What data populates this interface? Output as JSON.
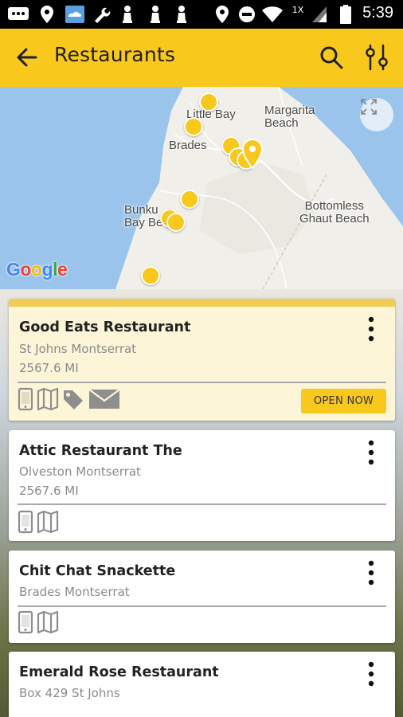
{
  "status_bar": {
    "time": "5:39",
    "icons": [
      "messages-icon",
      "location-pin-icon",
      "weather-icon",
      "wrench-icon",
      "chess-piece-icon",
      "chess-piece-icon",
      "chess-piece-icon",
      "location-icon",
      "do-not-disturb-icon",
      "wifi-icon",
      "signal-icon",
      "battery-icon"
    ],
    "signal_label": "1X"
  },
  "app_bar": {
    "title": "Restaurants",
    "background_color": "#f8c81c",
    "icons": [
      "back-arrow-icon",
      "search-icon",
      "filter-sliders-icon"
    ]
  },
  "map": {
    "labels": {
      "little_bay": "Little Bay",
      "margarita_beach": "Margarita\nBeach",
      "brades": "Brades",
      "bunkum_bay": "Bunku\nBay Be",
      "bottomless": "Bottomless\nGhaut Beach"
    },
    "google_logo": "Google",
    "expand_icon": "fullscreen-expand-icon",
    "pin_color": "#f8c81c"
  },
  "restaurants": [
    {
      "name": "Good Eats Restaurant",
      "address": "St Johns Montserrat",
      "distance": "2567.6 MI",
      "icons": [
        "phone-icon",
        "map-icon",
        "tag-icon",
        "mail-icon"
      ],
      "badge": "OPEN NOW",
      "highlighted": true
    },
    {
      "name": "Attic Restaurant The",
      "address": "Olveston Montserrat",
      "distance": "2567.6 MI",
      "icons": [
        "phone-icon",
        "map-icon"
      ],
      "badge": "",
      "highlighted": false
    },
    {
      "name": "Chit Chat Snackette",
      "address": "Brades Montserrat",
      "distance": "",
      "icons": [
        "phone-icon",
        "map-icon"
      ],
      "badge": "",
      "highlighted": false
    },
    {
      "name": "Emerald Rose Restaurant",
      "address": "Box 429 St Johns",
      "distance": "",
      "icons": [],
      "badge": "",
      "highlighted": false
    }
  ]
}
